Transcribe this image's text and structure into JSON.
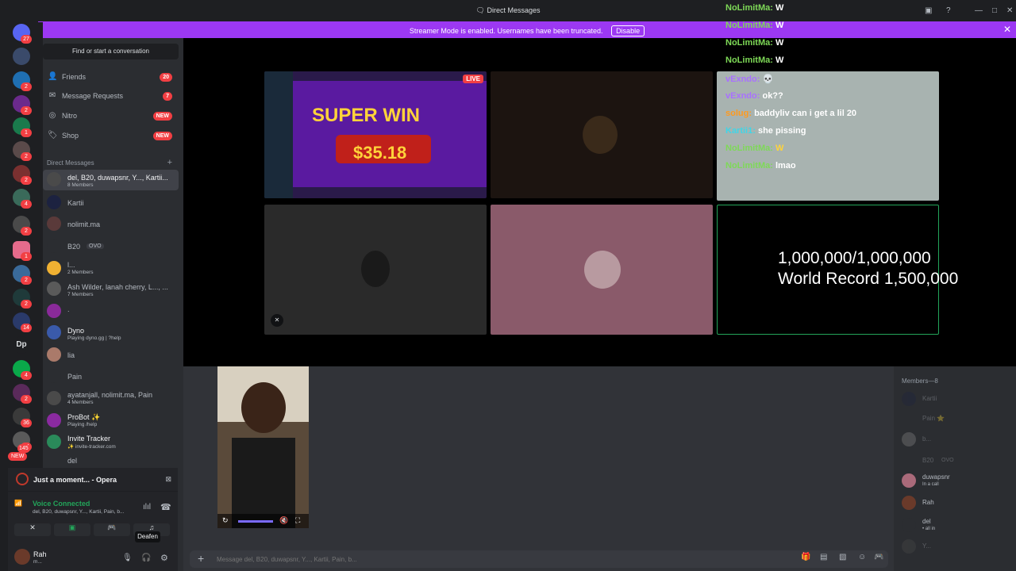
{
  "window": {
    "title": "Direct Messages",
    "controls": [
      "—",
      "□",
      "✕"
    ]
  },
  "banner": {
    "text": "Streamer Mode is enabled. Usernames have been truncated.",
    "button": "Disable"
  },
  "guild_rail": {
    "home_badge": "27",
    "badges": [
      "2",
      "2",
      "1",
      "2",
      "2",
      "4",
      "2",
      "1",
      "2",
      "2",
      "14",
      "4",
      "2",
      "36",
      "14",
      "145"
    ],
    "text_server": "Dp",
    "new_pill": "NEW"
  },
  "dm_sidebar": {
    "search_label": "Find or start a conversation",
    "nav": [
      {
        "label": "Friends",
        "badge": "20"
      },
      {
        "label": "Message Requests",
        "badge": "7"
      },
      {
        "label": "Nitro",
        "badge": "NEW"
      },
      {
        "label": "Shop",
        "badge": "NEW"
      }
    ],
    "section": "Direct Messages",
    "items": [
      {
        "name": "del, B20, duwapsnr, Y..., Kartii...",
        "sub": "8 Members",
        "selected": true
      },
      {
        "name": "Kartii",
        "sub": ""
      },
      {
        "name": "nolimit.ma",
        "sub": ""
      },
      {
        "name": "B20",
        "sub": ""
      },
      {
        "name": "l...",
        "sub": "2 Members"
      },
      {
        "name": "Ash Wilder, lanah cherry, L..., ...",
        "sub": "7 Members"
      },
      {
        "name": ".",
        "sub": ""
      },
      {
        "name": "Dyno",
        "sub": "Playing dyno.gg | ?help"
      },
      {
        "name": "lia",
        "sub": ""
      },
      {
        "name": "Pain",
        "sub": ""
      },
      {
        "name": "ayatanjall, nolimit.ma, Pain",
        "sub": "4 Members"
      },
      {
        "name": "ProBot ✨",
        "sub": "Playing /help"
      },
      {
        "name": "Invite Tracker",
        "sub": "✨ invite-tracker.com"
      },
      {
        "name": "del",
        "sub": ""
      }
    ],
    "b20_tag": "OVO"
  },
  "activity": {
    "text": "Just a moment... - Opera"
  },
  "voice": {
    "status": "Voice Connected",
    "channel": "del, B20, duwapsnr, Y..., Kartii, Pain, b..."
  },
  "tooltip": {
    "text": "Deafen"
  },
  "user": {
    "name": "Rah",
    "status": "m..."
  },
  "overlay_chat": [
    {
      "author": "NoLimitMa:",
      "text": "W",
      "color": "#7ed957"
    },
    {
      "author": "NoLimitMa:",
      "text": "W",
      "color": "#7ed957"
    },
    {
      "author": "NoLimitMa:",
      "text": "W",
      "color": "#7ed957"
    },
    {
      "author": "NoLimitMa:",
      "text": "W",
      "color": "#7ed957"
    },
    {
      "author": "vExndo:",
      "text": "💀",
      "color": "#a970ff"
    },
    {
      "author": "vExndo:",
      "text": "ok??",
      "color": "#a970ff"
    },
    {
      "author": "solug:",
      "text": "baddyliv can i get a lil 20",
      "color": "#ff9a1f"
    },
    {
      "author": "Kartii1:",
      "text": "she pissing",
      "color": "#3fd6e8"
    },
    {
      "author": "NoLimitMa:",
      "text": "W",
      "color": "#7ed957"
    },
    {
      "author": "NoLimitMa:",
      "text": "lmao",
      "color": "#7ed957"
    }
  ],
  "stream": {
    "live": "LIVE",
    "win_title": "SUPER WIN",
    "win_amount": "$35.18"
  },
  "counter": {
    "line1": "1,000,000/1,000,000",
    "line2": "World Record 1,500,000"
  },
  "composer": {
    "placeholder": "Message del, B20, duwapsnr, Y..., Kartii, Pain, b..."
  },
  "members": {
    "header": "Members—8",
    "list": [
      {
        "name": "Kartii",
        "sub": ""
      },
      {
        "name": "Pain ⭐",
        "sub": ""
      },
      {
        "name": "b...",
        "sub": ""
      },
      {
        "name": "B20",
        "sub": ""
      },
      {
        "name": "duwapsnr",
        "sub": "In a call"
      },
      {
        "name": "Rah",
        "sub": ""
      },
      {
        "name": "del",
        "sub": "• all in"
      },
      {
        "name": "Y...",
        "sub": ""
      }
    ],
    "b20_tag": "OVO"
  },
  "colors": {
    "accent": "#9c38f3",
    "green": "#23a55a",
    "red": "#f23f43",
    "bg": "#313338"
  }
}
